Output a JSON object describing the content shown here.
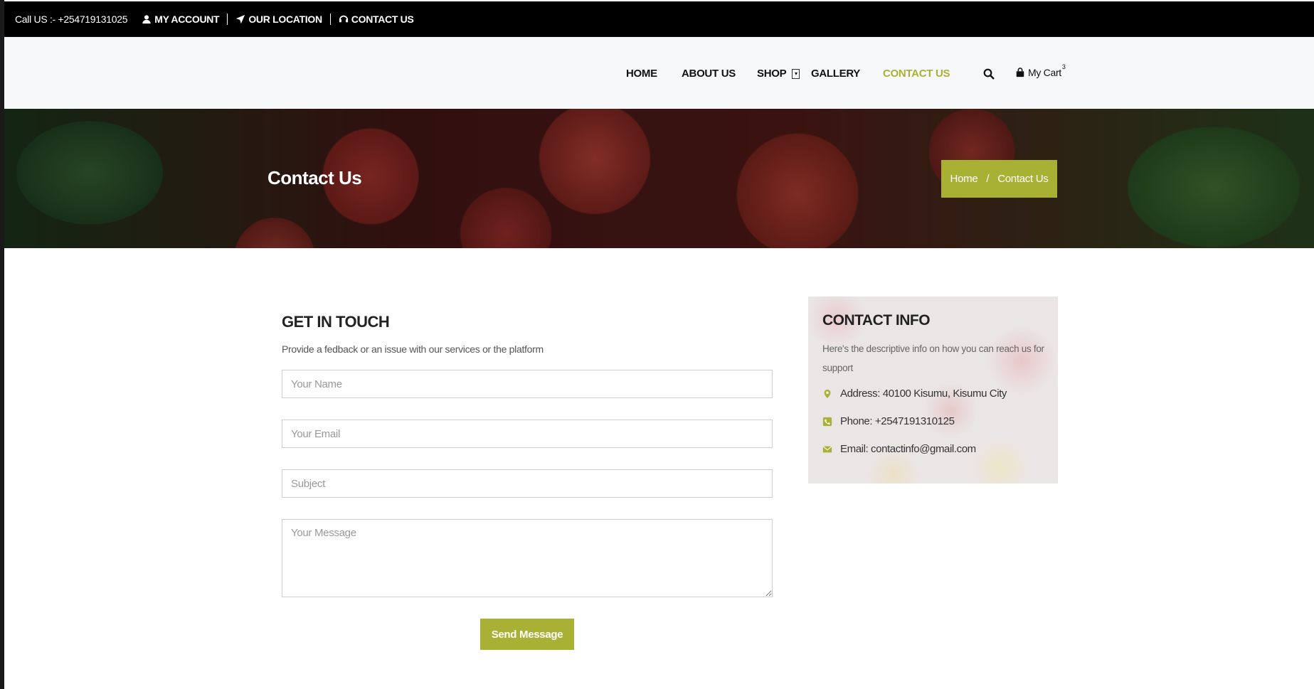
{
  "topbar": {
    "call": "Call US :- +254719131025",
    "my_account": "MY ACCOUNT",
    "our_location": "OUR LOCATION",
    "contact_us": "CONTACT US"
  },
  "nav": {
    "home": "HOME",
    "about": "ABOUT US",
    "shop": "SHOP",
    "gallery": "GALLERY",
    "contact": "CONTACT US",
    "cart_label": "My Cart",
    "cart_count": "3",
    "accent": "#a9b135"
  },
  "hero": {
    "title": "Contact Us",
    "breadcrumb_home": "Home",
    "breadcrumb_sep": "/",
    "breadcrumb_current": "Contact Us"
  },
  "form": {
    "title": "GET IN TOUCH",
    "subtitle": "Provide a fedback or an issue with our services or the platform",
    "name_placeholder": "Your Name",
    "email_placeholder": "Your Email",
    "subject_placeholder": "Subject",
    "message_placeholder": "Your Message",
    "send_label": "Send Message"
  },
  "info": {
    "title": "CONTACT INFO",
    "subtitle": "Here's the descriptive info on how you can reach us for support",
    "address": "Address: 40100 Kisumu, Kisumu City",
    "phone": "Phone: +2547191310125",
    "email": "Email: contactinfo@gmail.com"
  }
}
